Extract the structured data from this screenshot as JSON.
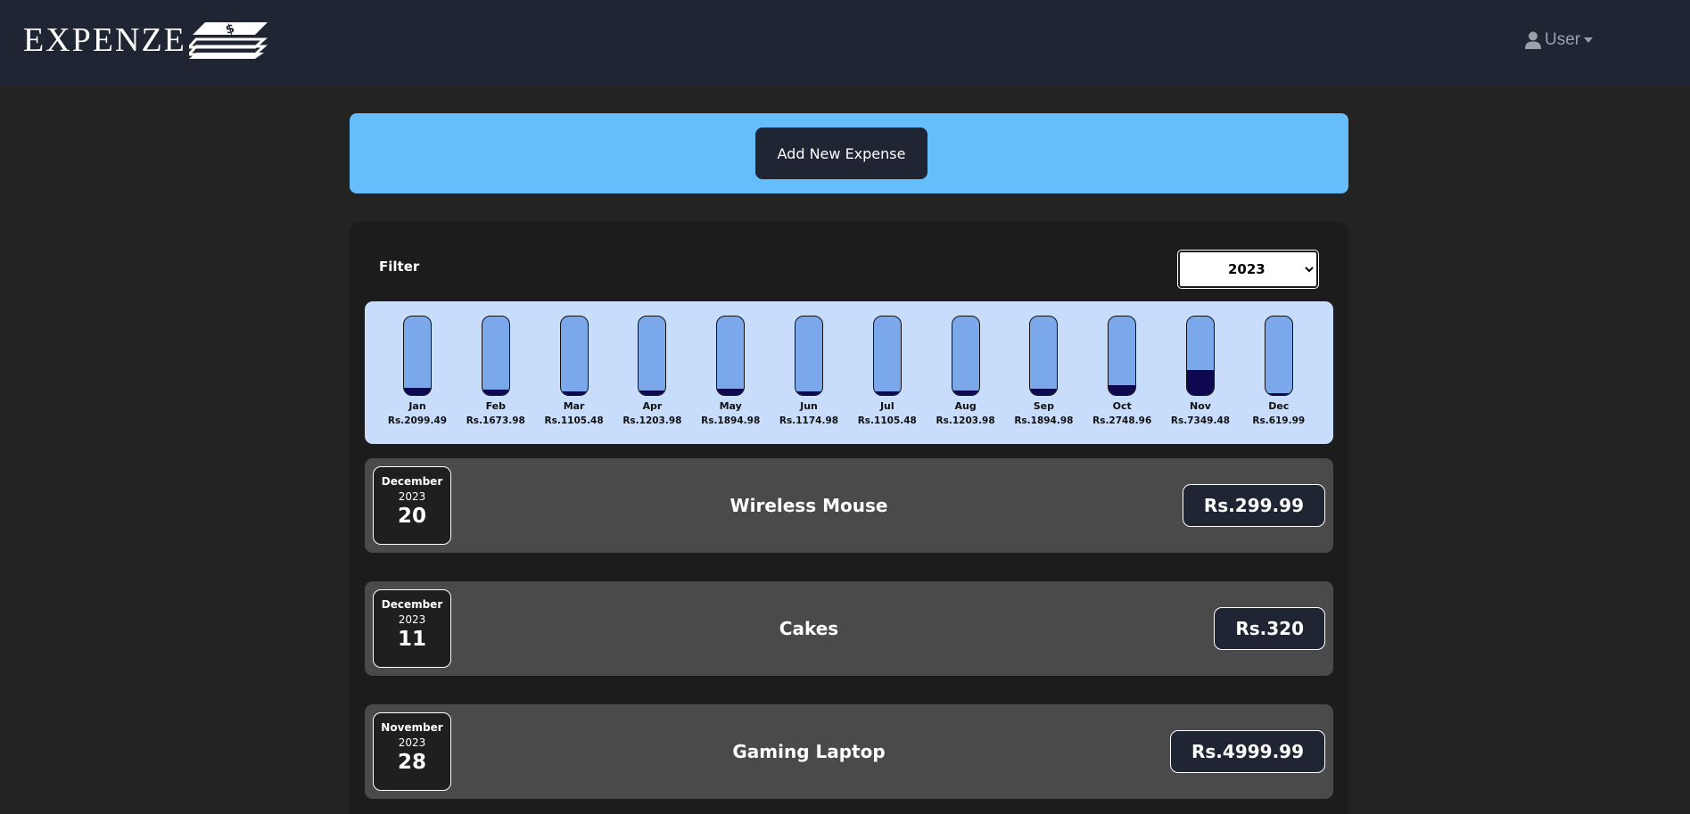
{
  "navbar": {
    "brand": "EXPENZE",
    "brand_logo_icon": "money-stack-icon",
    "user_label": "User"
  },
  "actions": {
    "add_expense_label": "Add New Expense"
  },
  "filter": {
    "label": "Filter",
    "selected_year": "2023"
  },
  "chart_data": {
    "type": "bar",
    "categories": [
      "Jan",
      "Feb",
      "Mar",
      "Apr",
      "May",
      "Jun",
      "Jul",
      "Aug",
      "Sep",
      "Oct",
      "Nov",
      "Dec"
    ],
    "values": [
      2099.49,
      1673.98,
      1105.48,
      1203.98,
      1894.98,
      1174.98,
      1105.48,
      1203.98,
      1894.98,
      2748.96,
      7349.48,
      619.99
    ],
    "labels": [
      "Rs.2099.49",
      "Rs.1673.98",
      "Rs.1105.48",
      "Rs.1203.98",
      "Rs.1894.98",
      "Rs.1174.98",
      "Rs.1105.48",
      "Rs.1203.98",
      "Rs.1894.98",
      "Rs.2748.96",
      "Rs.7349.48",
      "Rs.619.99"
    ],
    "colors": {
      "track": "#7aa8ea",
      "fill": "#0e0850",
      "background": "#c8dcfc"
    }
  },
  "expenses": [
    {
      "month": "December",
      "year": "2023",
      "day": "20",
      "title": "Wireless Mouse",
      "amount": "Rs.299.99"
    },
    {
      "month": "December",
      "year": "2023",
      "day": "11",
      "title": "Cakes",
      "amount": "Rs.320"
    },
    {
      "month": "November",
      "year": "2023",
      "day": "28",
      "title": "Gaming Laptop",
      "amount": "Rs.4999.99"
    }
  ]
}
